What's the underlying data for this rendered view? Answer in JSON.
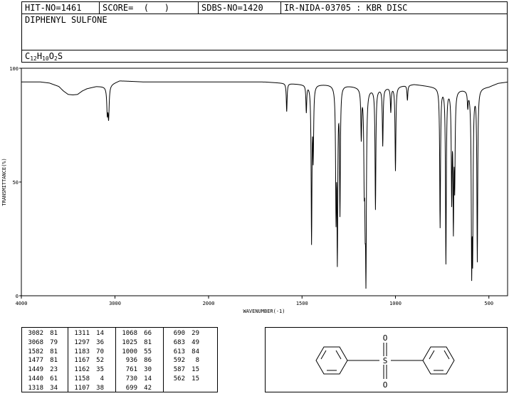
{
  "header": {
    "hit_no": "HIT-NO=1461",
    "score": "SCORE=  (   )",
    "sdbs_no": "SDBS-NO=1420",
    "method": "IR-NIDA-03705 : KBR DISC"
  },
  "compound": {
    "name": "DIPHENYL SULFONE",
    "formula_parts": [
      "C",
      "12",
      "H",
      "10",
      "O",
      "2",
      "S"
    ]
  },
  "chart_data": {
    "type": "line",
    "title": "",
    "xlabel": "WAVENUMBER(-1)",
    "ylabel": "TRANSMITTANCE(%)",
    "xlim": [
      4000,
      400
    ],
    "ylim": [
      0,
      100
    ],
    "x_ticks": [
      4000,
      3000,
      2000,
      1500,
      1000,
      500
    ],
    "y_ticks": [
      0,
      50,
      100
    ],
    "baseline": [
      [
        4000,
        94
      ],
      [
        3800,
        94
      ],
      [
        3700,
        93.5
      ],
      [
        3600,
        92
      ],
      [
        3550,
        90
      ],
      [
        3500,
        88.5
      ],
      [
        3450,
        88.3
      ],
      [
        3400,
        88.5
      ],
      [
        3350,
        90
      ],
      [
        3300,
        91
      ],
      [
        3200,
        92
      ],
      [
        3100,
        92
      ],
      [
        2950,
        94.5
      ],
      [
        2700,
        94
      ],
      [
        2400,
        94
      ],
      [
        2100,
        94
      ],
      [
        1900,
        94
      ],
      [
        1700,
        94
      ],
      [
        1600,
        93.5
      ],
      [
        1500,
        93
      ],
      [
        1400,
        93
      ],
      [
        1300,
        93
      ],
      [
        1200,
        92
      ],
      [
        1100,
        91
      ],
      [
        1000,
        92
      ],
      [
        900,
        93
      ],
      [
        800,
        92
      ],
      [
        700,
        91
      ],
      [
        600,
        91
      ],
      [
        500,
        92
      ],
      [
        450,
        93.5
      ],
      [
        400,
        94
      ]
    ],
    "peaks": [
      {
        "wavenumber": 3082,
        "transmittance": 81
      },
      {
        "wavenumber": 3068,
        "transmittance": 79
      },
      {
        "wavenumber": 1582,
        "transmittance": 81
      },
      {
        "wavenumber": 1477,
        "transmittance": 81
      },
      {
        "wavenumber": 1449,
        "transmittance": 23
      },
      {
        "wavenumber": 1440,
        "transmittance": 61
      },
      {
        "wavenumber": 1318,
        "transmittance": 34
      },
      {
        "wavenumber": 1311,
        "transmittance": 14
      },
      {
        "wavenumber": 1297,
        "transmittance": 36
      },
      {
        "wavenumber": 1183,
        "transmittance": 70
      },
      {
        "wavenumber": 1167,
        "transmittance": 52
      },
      {
        "wavenumber": 1162,
        "transmittance": 35
      },
      {
        "wavenumber": 1158,
        "transmittance": 4
      },
      {
        "wavenumber": 1107,
        "transmittance": 38
      },
      {
        "wavenumber": 1068,
        "transmittance": 66
      },
      {
        "wavenumber": 1025,
        "transmittance": 81
      },
      {
        "wavenumber": 1000,
        "transmittance": 55
      },
      {
        "wavenumber": 936,
        "transmittance": 86
      },
      {
        "wavenumber": 761,
        "transmittance": 30
      },
      {
        "wavenumber": 730,
        "transmittance": 14
      },
      {
        "wavenumber": 699,
        "transmittance": 42
      },
      {
        "wavenumber": 690,
        "transmittance": 29
      },
      {
        "wavenumber": 683,
        "transmittance": 49
      },
      {
        "wavenumber": 613,
        "transmittance": 84
      },
      {
        "wavenumber": 592,
        "transmittance": 8
      },
      {
        "wavenumber": 587,
        "transmittance": 15
      },
      {
        "wavenumber": 562,
        "transmittance": 15
      }
    ]
  },
  "peak_table": {
    "columns": [
      [
        [
          "3082",
          "81"
        ],
        [
          "3068",
          "79"
        ],
        [
          "1582",
          "81"
        ],
        [
          "1477",
          "81"
        ],
        [
          "1449",
          "23"
        ],
        [
          "1440",
          "61"
        ],
        [
          "1318",
          "34"
        ]
      ],
      [
        [
          "1311",
          "14"
        ],
        [
          "1297",
          "36"
        ],
        [
          "1183",
          "70"
        ],
        [
          "1167",
          "52"
        ],
        [
          "1162",
          "35"
        ],
        [
          "1158",
          "4"
        ],
        [
          "1107",
          "38"
        ]
      ],
      [
        [
          "1068",
          "66"
        ],
        [
          "1025",
          "81"
        ],
        [
          "1000",
          "55"
        ],
        [
          "936",
          "86"
        ],
        [
          "761",
          "30"
        ],
        [
          "730",
          "14"
        ],
        [
          "699",
          "42"
        ]
      ],
      [
        [
          "690",
          "29"
        ],
        [
          "683",
          "49"
        ],
        [
          "613",
          "84"
        ],
        [
          "592",
          "8"
        ],
        [
          "587",
          "15"
        ],
        [
          "562",
          "15"
        ]
      ]
    ]
  },
  "structure": {
    "atom_s": "S",
    "atom_o_top": "O",
    "atom_o_bottom": "O"
  }
}
